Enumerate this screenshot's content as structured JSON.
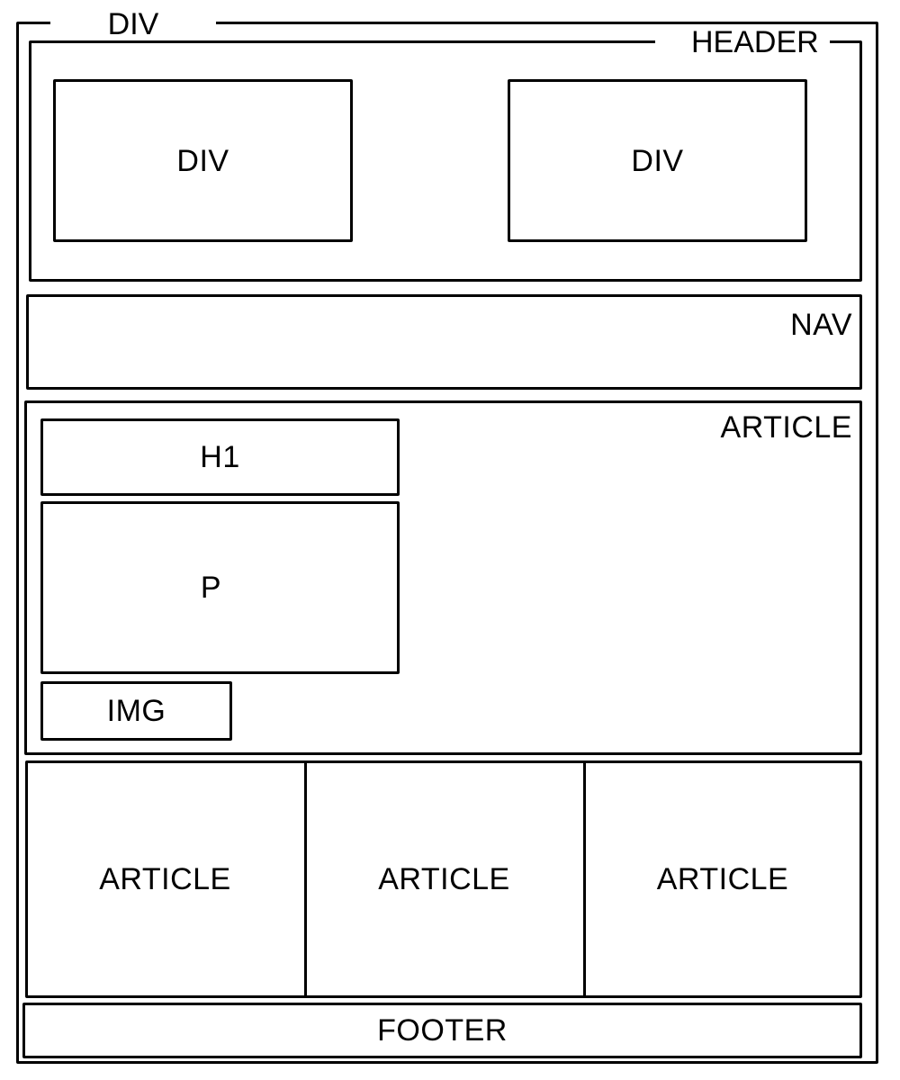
{
  "wrapper": {
    "label": "DIV"
  },
  "header": {
    "label": "HEADER",
    "left_box": {
      "label": "DIV"
    },
    "right_box": {
      "label": "DIV"
    }
  },
  "nav": {
    "label": "NAV"
  },
  "main_article": {
    "label": "ARTICLE",
    "h1": {
      "label": "H1"
    },
    "p": {
      "label": "P"
    },
    "img": {
      "label": "IMG"
    }
  },
  "articles": [
    {
      "label": "ARTICLE"
    },
    {
      "label": "ARTICLE"
    },
    {
      "label": "ARTICLE"
    }
  ],
  "footer": {
    "label": "FOOTER"
  }
}
